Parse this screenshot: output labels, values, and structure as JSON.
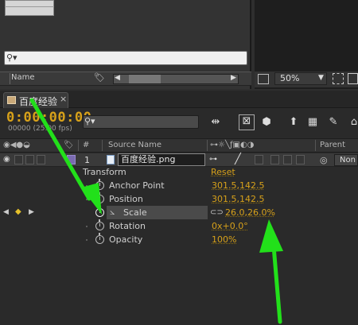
{
  "project_panel": {
    "name_column": "Name",
    "search_placeholder": ""
  },
  "composition_panel": {
    "zoom": "50%"
  },
  "timeline": {
    "tab_label": "百度经验",
    "timecode": "0:00:00:00",
    "frame_info": "00000 (25.00 fps)",
    "columns": {
      "number": "#",
      "source_name": "Source Name",
      "parent": "Parent"
    },
    "layer": {
      "number": "1",
      "name": "百度经验.png",
      "parent": "Non"
    },
    "transform": {
      "label": "Transform",
      "reset": "Reset",
      "properties": [
        {
          "label": "Anchor Point",
          "value": "301.5,142.5"
        },
        {
          "label": "Position",
          "value": "301.5,142.5"
        },
        {
          "label": "Scale",
          "value": "26.0,26.0%"
        },
        {
          "label": "Rotation",
          "value": "0x+0.0°"
        },
        {
          "label": "Opacity",
          "value": "100%"
        }
      ]
    }
  },
  "colors": {
    "accent_timecode": "#d7a11a",
    "annotation_arrow": "#22e01a"
  }
}
